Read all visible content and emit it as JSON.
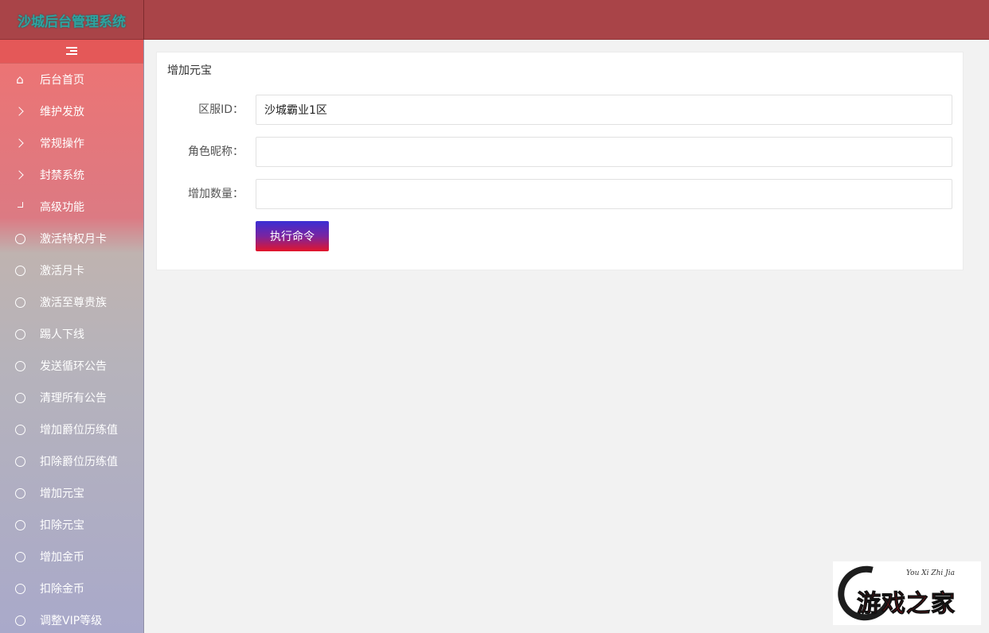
{
  "header": {
    "logo_text": "沙城后台管理系统"
  },
  "sidebar": {
    "toggle_icon": "menu-fold-icon",
    "items": [
      {
        "label": "后台首页",
        "icon": "home-icon"
      },
      {
        "label": "维护发放",
        "icon": "chevron-right-icon"
      },
      {
        "label": "常规操作",
        "icon": "chevron-right-icon"
      },
      {
        "label": "封禁系统",
        "icon": "chevron-right-icon"
      },
      {
        "label": "高级功能",
        "icon": "corner-down-icon"
      }
    ],
    "subitems": [
      {
        "label": "激活特权月卡"
      },
      {
        "label": "激活月卡"
      },
      {
        "label": "激活至尊贵族"
      },
      {
        "label": "踢人下线"
      },
      {
        "label": "发送循环公告"
      },
      {
        "label": "清理所有公告"
      },
      {
        "label": "增加爵位历练值"
      },
      {
        "label": "扣除爵位历练值"
      },
      {
        "label": "增加元宝"
      },
      {
        "label": "扣除元宝"
      },
      {
        "label": "增加金币"
      },
      {
        "label": "扣除金币"
      },
      {
        "label": "调整VIP等级"
      }
    ]
  },
  "form": {
    "title": "增加元宝",
    "server_label": "区服ID：",
    "server_value": "沙城霸业1区",
    "nickname_label": "角色昵称：",
    "nickname_value": "",
    "amount_label": "增加数量：",
    "amount_value": "",
    "submit_label": "执行命令"
  },
  "watermark": {
    "script_text": "You Xi Zhi Jia",
    "text": "游戏之家"
  },
  "colors": {
    "header_bg": "#a94448",
    "button_top": "#3b2fd4",
    "button_bottom": "#e3152a"
  }
}
